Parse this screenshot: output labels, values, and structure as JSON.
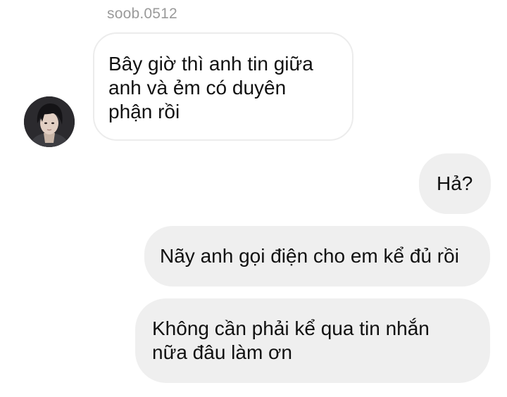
{
  "thread": {
    "sender_name": "soob.0512",
    "incoming": {
      "lines": [
        "Bây giờ thì anh tin giữa",
        "anh và ẻm có duyên",
        "phận rồi"
      ]
    },
    "outgoing": [
      {
        "lines": [
          "Hả?"
        ]
      },
      {
        "lines": [
          "Nãy anh gọi điện cho em kể đủ rồi"
        ]
      },
      {
        "lines": [
          "Không cần phải kể qua tin nhắn",
          "nữa đâu làm ơn"
        ]
      }
    ]
  },
  "colors": {
    "sender_name": "#9a9a9a",
    "incoming_bubble_border": "#ececec",
    "outgoing_bubble": "#efefef",
    "text": "#111111"
  },
  "icons": {
    "avatar": "profile-photo"
  }
}
